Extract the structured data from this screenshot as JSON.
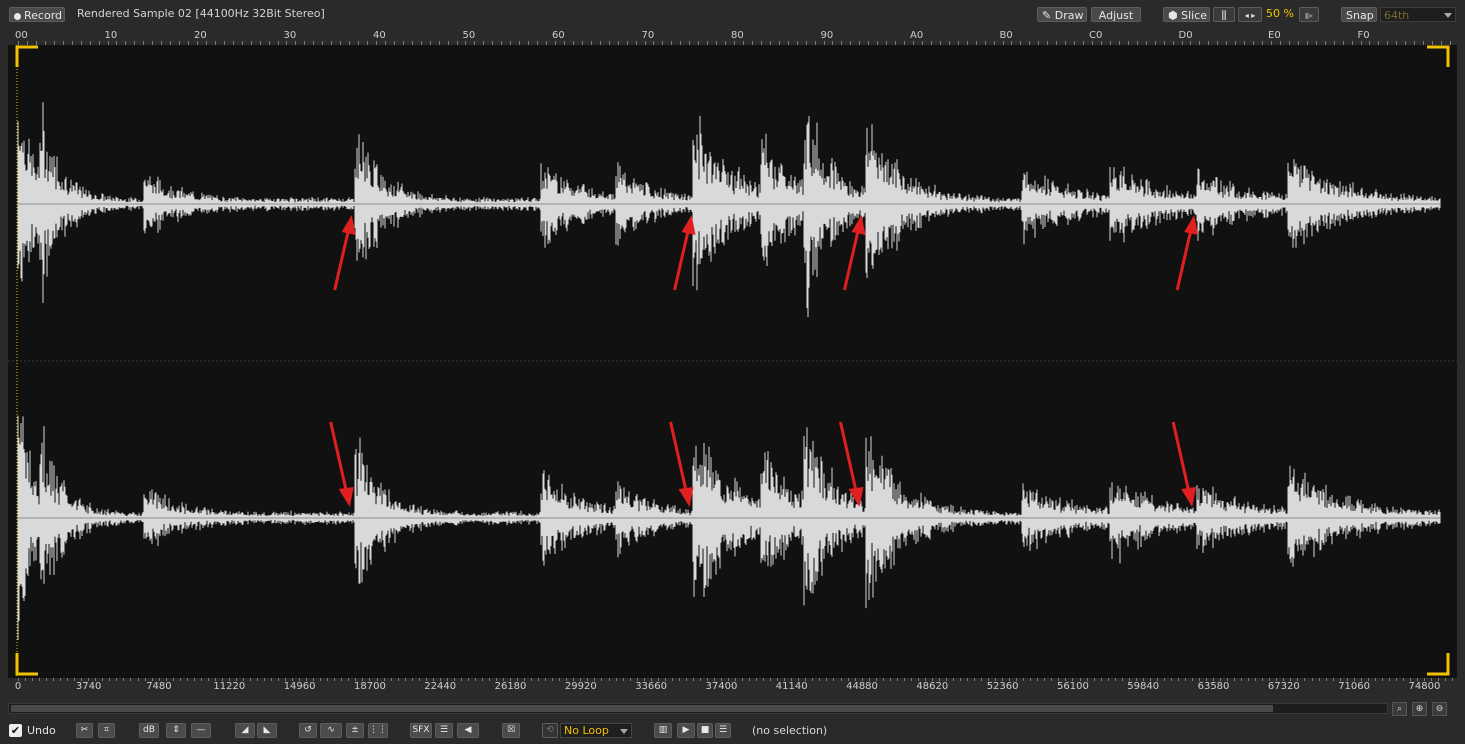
{
  "toolbar": {
    "record_label": "Record",
    "sample_title": "Rendered Sample 02 [44100Hz 32Bit Stereo]",
    "draw_label": "Draw",
    "adjust_label": "Adjust",
    "slice_label": "Slice",
    "zoom_value": "50 %",
    "snap_label": "Snap",
    "snap_value": "64th"
  },
  "ruler_top": {
    "labels": [
      "00",
      "10",
      "20",
      "30",
      "40",
      "50",
      "60",
      "70",
      "80",
      "90",
      "A0",
      "B0",
      "C0",
      "D0",
      "E0",
      "F0"
    ]
  },
  "ruler_bottom": {
    "labels": [
      "0",
      "3740",
      "7480",
      "11220",
      "14960",
      "18700",
      "22440",
      "26180",
      "29920",
      "33660",
      "37400",
      "41140",
      "44880",
      "48620",
      "52360",
      "56100",
      "59840",
      "63580",
      "67320",
      "71060",
      "74800"
    ]
  },
  "waveform": {
    "channels": 2,
    "sample_count": 79500,
    "background": "#111111",
    "wave_color": "#d9d9d9",
    "marker_color": "#f2c200",
    "arrow_color": "#e02020",
    "slice_points": [
      18600,
      37600,
      47100,
      65700
    ]
  },
  "bottombar": {
    "undo_label": "Undo",
    "loop_value": "No Loop",
    "sfx_label": "SFX",
    "db_label": "dB",
    "selection_status": "(no selection)"
  },
  "colors": {
    "accent": "#f2c200",
    "panel": "#2a2a2a"
  }
}
